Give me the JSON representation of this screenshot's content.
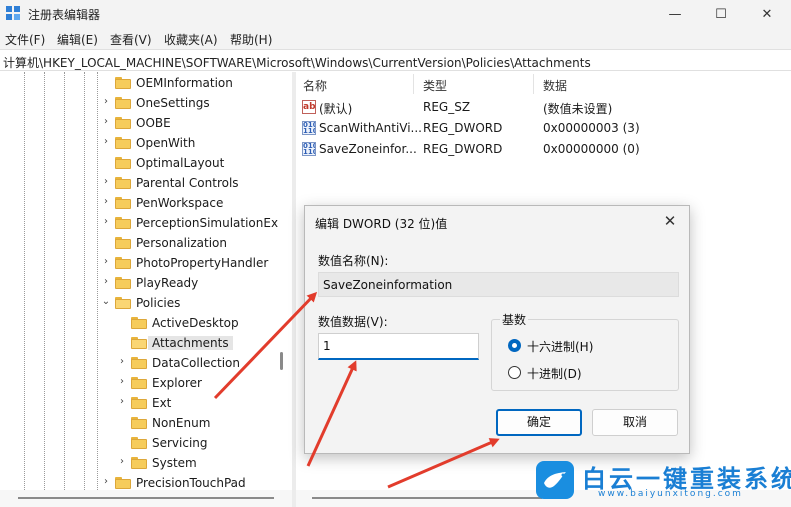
{
  "window": {
    "title": "注册表编辑器"
  },
  "menu": [
    "文件(F)",
    "编辑(E)",
    "查看(V)",
    "收藏夹(A)",
    "帮助(H)"
  ],
  "address": "计算机\\HKEY_LOCAL_MACHINE\\SOFTWARE\\Microsoft\\Windows\\CurrentVersion\\Policies\\Attachments",
  "tree": [
    {
      "label": "OEMInformation",
      "level": 1,
      "chevron": ""
    },
    {
      "label": "OneSettings",
      "level": 1,
      "chevron": ">"
    },
    {
      "label": "OOBE",
      "level": 1,
      "chevron": ">"
    },
    {
      "label": "OpenWith",
      "level": 1,
      "chevron": ">"
    },
    {
      "label": "OptimalLayout",
      "level": 1,
      "chevron": ""
    },
    {
      "label": "Parental Controls",
      "level": 1,
      "chevron": ">"
    },
    {
      "label": "PenWorkspace",
      "level": 1,
      "chevron": ">"
    },
    {
      "label": "PerceptionSimulationEx",
      "level": 1,
      "chevron": ">"
    },
    {
      "label": "Personalization",
      "level": 1,
      "chevron": ""
    },
    {
      "label": "PhotoPropertyHandler",
      "level": 1,
      "chevron": ">"
    },
    {
      "label": "PlayReady",
      "level": 1,
      "chevron": ">"
    },
    {
      "label": "Policies",
      "level": 1,
      "chevron": "v",
      "open": true
    },
    {
      "label": "ActiveDesktop",
      "level": 2,
      "chevron": ""
    },
    {
      "label": "Attachments",
      "level": 2,
      "chevron": "",
      "selected": true,
      "open": true
    },
    {
      "label": "DataCollection",
      "level": 2,
      "chevron": ">"
    },
    {
      "label": "Explorer",
      "level": 2,
      "chevron": ">"
    },
    {
      "label": "Ext",
      "level": 2,
      "chevron": ">"
    },
    {
      "label": "NonEnum",
      "level": 2,
      "chevron": ""
    },
    {
      "label": "Servicing",
      "level": 2,
      "chevron": ""
    },
    {
      "label": "System",
      "level": 2,
      "chevron": ">"
    },
    {
      "label": "PrecisionTouchPad",
      "level": 1,
      "chevron": ">"
    }
  ],
  "list": {
    "headers": {
      "name": "名称",
      "type": "类型",
      "data": "数据"
    },
    "rows": [
      {
        "icon": "ab",
        "name": "(默认)",
        "type": "REG_SZ",
        "data": "(数值未设置)"
      },
      {
        "icon": "dword",
        "name": "ScanWithAntiVi...",
        "type": "REG_DWORD",
        "data": "0x00000003 (3)"
      },
      {
        "icon": "dword",
        "name": "SaveZoneinfor...",
        "type": "REG_DWORD",
        "data": "0x00000000 (0)"
      }
    ]
  },
  "dialog": {
    "title": "编辑 DWORD (32 位)值",
    "name_label": "数值名称(N):",
    "name_value": "SaveZoneinformation",
    "data_label": "数值数据(V):",
    "data_value": "1",
    "radix_label": "基数",
    "hex_label": "十六进制(H)",
    "dec_label": "十进制(D)",
    "ok_label": "确定",
    "cancel_label": "取消"
  },
  "watermark": {
    "text": "白云一键重装系统",
    "url": "www.baiyunxitong.com"
  },
  "colors": {
    "accent": "#0067c0",
    "arrow": "#e23c2c",
    "folder": "#f6cc5b"
  }
}
